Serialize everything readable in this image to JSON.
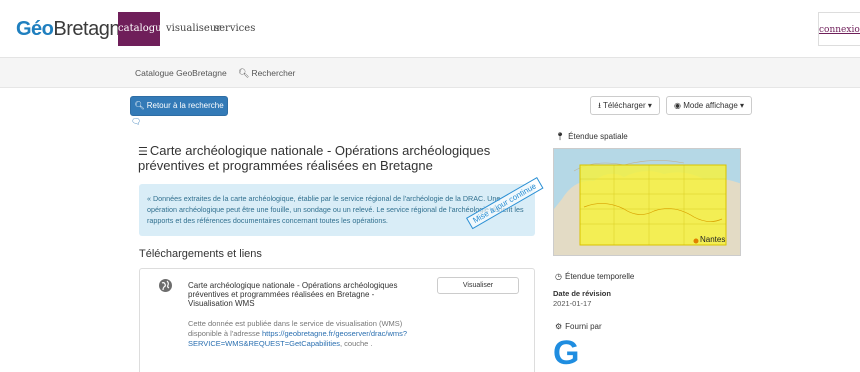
{
  "header": {
    "logo_geo": "Géo",
    "logo_bretagne": "Bretagne",
    "logo_reg": "®",
    "tabs": [
      {
        "label": "catalogue",
        "active": true
      },
      {
        "label": "visualiseur",
        "active": false
      },
      {
        "label": "services",
        "active": false
      }
    ],
    "login_label": "connexion"
  },
  "breadcrumb": {
    "home": "Catalogue GeoBretagne",
    "search": "Rechercher",
    "search_icon": "search-icon"
  },
  "toolbar": {
    "back_label": "Retour à la recherche",
    "download_label": "Télécharger",
    "mode_label": "Mode affichage"
  },
  "record": {
    "title": "Carte archéologique nationale - Opérations archéologiques préventives et programmées réalisées en Bretagne",
    "abstract": "« Données extraites de la carte archéologique, établie par le service régional de l'archéologie de la DRAC. Une opération archéologique peut être une fouille, un sondage ou un relevé. Le service régional de l'archéologie détient les rapports et des références documentaires concernant toutes les opérations.",
    "stamp": "Mise à jour continue",
    "links_heading": "Téléchargements et liens",
    "link": {
      "title": "Carte archéologique nationale - Opérations archéologiques préventives et programmées réalisées en Bretagne - Visualisation WMS",
      "desc_prefix": "Cette donnée est publiée dans le service de visualisation (WMS) disponible à l'adresse",
      "url": "https://geobretagne.fr/geoserver/drac/wms?SERVICE=WMS&REQUEST=GetCapabilities",
      "desc_suffix": ", couche .",
      "button": "Visualiser"
    }
  },
  "sidebar": {
    "spatial_heading": "Étendue spatiale",
    "map_label": "Nantes",
    "temporal_heading": "Étendue temporelle",
    "revision_label": "Date de révision",
    "revision_date": "2021-01-17",
    "provider_heading": "Fourni par",
    "provider_logo": "G"
  },
  "colors": {
    "accent": "#6f1f5a",
    "primary_button": "#337ab7",
    "alert_bg": "#d9edf7",
    "logo_blue": "#1f8de0"
  }
}
